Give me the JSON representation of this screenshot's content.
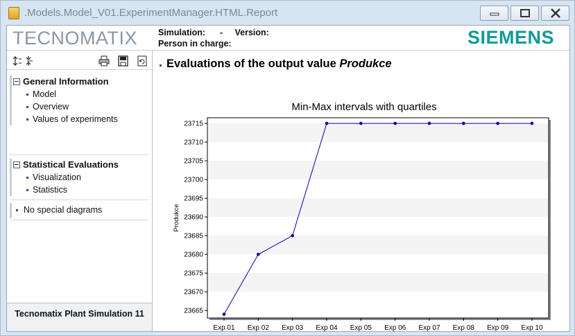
{
  "window": {
    "title": ".Models.Model_V01.ExperimentManager.HTML.Report"
  },
  "header": {
    "product_logo": "TECNOMATIX",
    "brand_logo": "SIEMENS",
    "simulation_label": "Simulation:",
    "simulation_value": "-",
    "version_label": "Version:",
    "person_label": "Person in charge:"
  },
  "sidebar": {
    "groups": [
      {
        "label": "General Information",
        "items": [
          "Model",
          "Overview",
          "Values of experiments"
        ]
      },
      {
        "label": "Statistical Evaluations",
        "items": [
          "Visualization",
          "Statistics"
        ]
      }
    ],
    "plain_item": "No special diagrams",
    "footer": "Tecnomatix Plant Simulation 11"
  },
  "icons": {
    "expand_all": "expand-all-icon",
    "collapse_all": "collapse-all-icon",
    "print": "print-icon",
    "save": "save-icon",
    "refresh": "refresh-icon"
  },
  "main": {
    "title_prefix": "Evaluations of the output value ",
    "title_var": "Produkce"
  },
  "chart_data": {
    "type": "line",
    "title": "Min-Max intervals with quartiles",
    "xlabel": "",
    "ylabel": "Produkce",
    "categories": [
      "Exp 01",
      "Exp 02",
      "Exp 03",
      "Exp 04",
      "Exp 05",
      "Exp 06",
      "Exp 07",
      "Exp 08",
      "Exp 09",
      "Exp 10"
    ],
    "values": [
      23664,
      23680,
      23685,
      23715,
      23715,
      23715,
      23715,
      23715,
      23715,
      23715
    ],
    "yticks": [
      23665,
      23670,
      23675,
      23680,
      23685,
      23690,
      23695,
      23700,
      23705,
      23710,
      23715
    ],
    "ylim": [
      23663,
      23716.5
    ],
    "grid": "horizontal bands",
    "colors": {
      "line": "#0000aa",
      "marker": "#0000aa",
      "band": "#f4f4f4"
    }
  }
}
